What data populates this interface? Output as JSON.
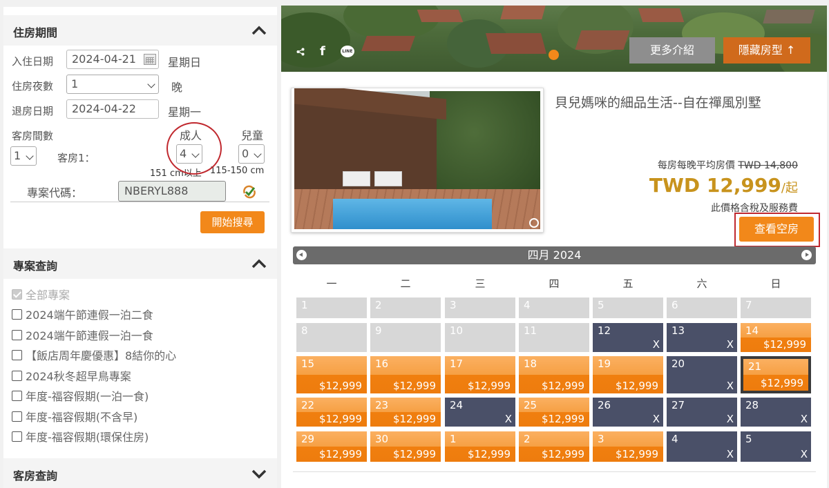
{
  "stay": {
    "section_title": "住房期間",
    "checkin_label": "入住日期",
    "checkin_value": "2024-04-21",
    "checkin_weekday": "星期日",
    "nights_label": "住房夜數",
    "nights_value": "1",
    "nights_unit": "晚",
    "checkout_label": "退房日期",
    "checkout_value": "2024-04-22",
    "checkout_weekday": "星期一",
    "rooms_label": "客房間數",
    "rooms_value": "1",
    "room1_label": "客房1：",
    "adults_label": "成人",
    "adults_value": "4",
    "adults_note": "151 cm以上",
    "children_label": "兒童",
    "children_value": "0",
    "children_note": "115-150 cm",
    "promo_label": "專案代碼：",
    "promo_value": "NBERYL888",
    "search_button": "開始搜尋"
  },
  "packages": {
    "section_title": "專案查詢",
    "items": [
      {
        "label": "全部專案",
        "checked": true
      },
      {
        "label": "2024端午節連假一泊二食",
        "checked": false
      },
      {
        "label": "2024端午節連假一泊一食",
        "checked": false
      },
      {
        "label": "【飯店周年慶優惠】8結你的心",
        "checked": false
      },
      {
        "label": "2024秋冬超早鳥專案",
        "checked": false
      },
      {
        "label": "年度-福容假期(一泊一食)",
        "checked": false
      },
      {
        "label": "年度-福容假期(不含早)",
        "checked": false
      },
      {
        "label": "年度-福容假期(環保住房)",
        "checked": false
      }
    ]
  },
  "rooms_section": {
    "section_title": "客房查詢"
  },
  "banner": {
    "more_button": "更多介紹",
    "hide_button": "隱藏房型 ↑",
    "share_icon": "share-icon",
    "facebook_icon": "f",
    "line_icon": "LINE"
  },
  "room": {
    "title": "貝兒媽咪的細品生活--自在禪風別墅",
    "avg_label": "每房每晚平均房價",
    "original_price": "TWD 14,800",
    "price": "TWD 12,999",
    "price_suffix": "/起",
    "tax_note": "此價格含稅及服務費",
    "view_button": "查看空房"
  },
  "calendar": {
    "month": "四月 2024",
    "weekdays": [
      "一",
      "二",
      "三",
      "四",
      "五",
      "六",
      "日"
    ],
    "unavailable_mark": "X",
    "cells": [
      {
        "d": "1",
        "s": "gray"
      },
      {
        "d": "2",
        "s": "gray"
      },
      {
        "d": "3",
        "s": "gray"
      },
      {
        "d": "4",
        "s": "gray"
      },
      {
        "d": "5",
        "s": "gray"
      },
      {
        "d": "6",
        "s": "gray"
      },
      {
        "d": "7",
        "s": "gray"
      },
      {
        "d": "8",
        "s": "gray"
      },
      {
        "d": "9",
        "s": "gray"
      },
      {
        "d": "10",
        "s": "gray"
      },
      {
        "d": "11",
        "s": "gray"
      },
      {
        "d": "12",
        "s": "navy"
      },
      {
        "d": "13",
        "s": "navy"
      },
      {
        "d": "14",
        "s": "orange",
        "p": "$12,999"
      },
      {
        "d": "15",
        "s": "orange",
        "p": "$12,999"
      },
      {
        "d": "16",
        "s": "orange",
        "p": "$12,999"
      },
      {
        "d": "17",
        "s": "orange",
        "p": "$12,999"
      },
      {
        "d": "18",
        "s": "orange",
        "p": "$12,999"
      },
      {
        "d": "19",
        "s": "orange",
        "p": "$12,999"
      },
      {
        "d": "20",
        "s": "navy"
      },
      {
        "d": "21",
        "s": "selected",
        "p": "$12,999"
      },
      {
        "d": "22",
        "s": "orange",
        "p": "$12,999"
      },
      {
        "d": "23",
        "s": "orange",
        "p": "$12,999"
      },
      {
        "d": "24",
        "s": "navy"
      },
      {
        "d": "25",
        "s": "orange",
        "p": "$12,999"
      },
      {
        "d": "26",
        "s": "navy"
      },
      {
        "d": "27",
        "s": "navy"
      },
      {
        "d": "28",
        "s": "navy"
      },
      {
        "d": "29",
        "s": "orange",
        "p": "$12,999"
      },
      {
        "d": "30",
        "s": "orange",
        "p": "$12,999"
      },
      {
        "d": "1",
        "s": "orange",
        "p": "$12,999"
      },
      {
        "d": "2",
        "s": "orange",
        "p": "$12,999"
      },
      {
        "d": "3",
        "s": "orange",
        "p": "$12,999"
      },
      {
        "d": "4",
        "s": "navy"
      },
      {
        "d": "5",
        "s": "navy"
      }
    ]
  },
  "colors": {
    "accent": "#f2881a",
    "unavailable": "#4a5068",
    "past": "#d7d7d7",
    "price": "#c8931d",
    "annotation": "#c0282e"
  }
}
